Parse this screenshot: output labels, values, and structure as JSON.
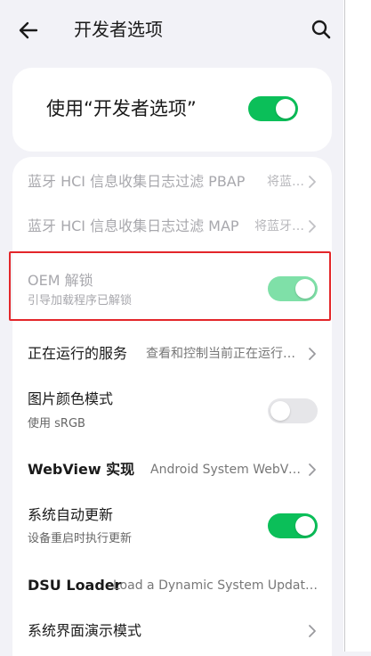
{
  "header": {
    "title": "开发者选项"
  },
  "master": {
    "label": "使用“开发者选项”",
    "enabled": true
  },
  "rows": [
    {
      "title": "蓝牙 HCI 信息收集日志过滤 PBAP",
      "value": "将蓝…",
      "state": "disabled"
    },
    {
      "title": "蓝牙 HCI 信息收集日志过滤 MAP",
      "value": "将蓝牙…",
      "state": "disabled"
    },
    {
      "title": "OEM 解锁",
      "subtitle": "引导加载程序已解锁",
      "toggle": true,
      "state": "disabled"
    },
    {
      "title": "正在运行的服务",
      "value": "查看和控制当前正在运行…"
    },
    {
      "title": "图片颜色模式",
      "subtitle": "使用 sRGB",
      "toggle": false
    },
    {
      "title": "WebView 实现",
      "value": "Android System WebView"
    },
    {
      "title": "系统自动更新",
      "subtitle": "设备重启时执行更新",
      "toggle": true
    },
    {
      "title": "DSU Loader",
      "value": "Load a Dynamic System Update I..."
    },
    {
      "title": "系统界面演示模式"
    }
  ],
  "colors": {
    "accent": "#0bbf59",
    "accent_disabled": "#7fe0a8",
    "highlight": "#e3262a",
    "background": "#f2f2f7"
  },
  "icons": [
    "back-arrow-icon",
    "search-icon",
    "chevron-right-icon"
  ]
}
